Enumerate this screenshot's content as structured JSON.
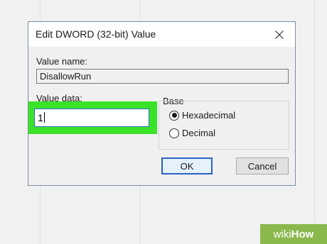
{
  "dialog": {
    "title": "Edit DWORD (32-bit) Value",
    "value_name_label": "Value name:",
    "value_name": "DisallowRun",
    "value_data_label": "Value data:",
    "value_data": "1",
    "base_label": "Base",
    "base_options": [
      {
        "label": "Hexadecimal",
        "selected": true
      },
      {
        "label": "Decimal",
        "selected": false
      }
    ],
    "ok_label": "OK",
    "cancel_label": "Cancel"
  },
  "watermark": {
    "prefix": "wiki",
    "suffix": "How"
  },
  "colors": {
    "highlight": "#3be22a",
    "accent": "#2a63c4",
    "watermark": "#8bb84d"
  },
  "icons": {
    "close": "close-icon"
  }
}
